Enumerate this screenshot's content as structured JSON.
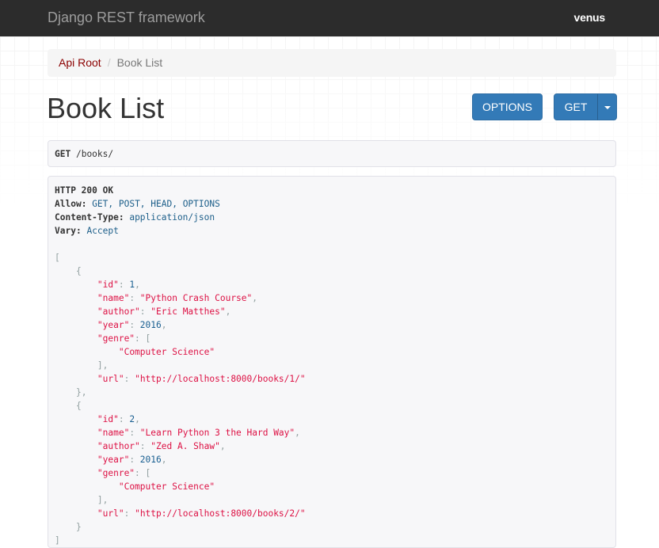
{
  "navbar": {
    "brand": "Django REST framework",
    "user": "venus"
  },
  "breadcrumb": [
    {
      "label": "Api Root"
    },
    {
      "label": "Book List"
    }
  ],
  "page_title": "Book List",
  "buttons": {
    "options": "OPTIONS",
    "get": "GET"
  },
  "request": {
    "method": "GET",
    "path": "/books/"
  },
  "response": {
    "status": "HTTP 200 OK",
    "headers": [
      {
        "name": "Allow",
        "value": "GET, POST, HEAD, OPTIONS"
      },
      {
        "name": "Content-Type",
        "value": "application/json"
      },
      {
        "name": "Vary",
        "value": "Accept"
      }
    ],
    "body": [
      {
        "id": 1,
        "name": "Python Crash Course",
        "author": "Eric Matthes",
        "year": 2016,
        "genre": [
          "Computer Science"
        ],
        "url": "http://localhost:8000/books/1/"
      },
      {
        "id": 2,
        "name": "Learn Python 3 the Hard Way",
        "author": "Zed A. Shaw",
        "year": 2016,
        "genre": [
          "Computer Science"
        ],
        "url": "http://localhost:8000/books/2/"
      }
    ]
  },
  "colors": {
    "navbar": "#2c2c2c",
    "primary": "#337ab7",
    "link": "#8b0000",
    "string": "#dd1144",
    "number": "#195f91"
  }
}
